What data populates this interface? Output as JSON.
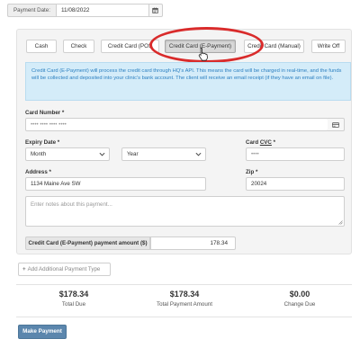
{
  "payment_date": {
    "label": "Payment Date:",
    "value": "11/08/2022",
    "icon": "calendar-icon"
  },
  "tabs": [
    {
      "label": "Cash",
      "active": false
    },
    {
      "label": "Check",
      "active": false
    },
    {
      "label": "Credit Card (POS",
      "active": false
    },
    {
      "label": "Credit Card (E-Payment)",
      "active": true
    },
    {
      "label": "Credit Card (Manual)",
      "active": false
    },
    {
      "label": "Write Off",
      "active": false
    }
  ],
  "info_message": "Credit Card (E-Payment) will process the credit card through HQ's API. This means the card will be charged in real-time, and the funds will be collected and deposited into your clinic's bank account. The client will receive an email receipt (if they have an email on file).",
  "card_number": {
    "label": "Card Number *",
    "placeholder": "•••• •••• •••• ••••",
    "icon": "credit-card-icon"
  },
  "expiry": {
    "label": "Expiry Date *",
    "month": "Month",
    "year": "Year"
  },
  "cvc": {
    "label_prefix": "Card ",
    "label_abbr": "CVC",
    "label_suffix": " *",
    "placeholder": "••••"
  },
  "address": {
    "label": "Address *",
    "value": "1134 Maine Ave SW"
  },
  "zip": {
    "label": "Zip *",
    "value": "20024"
  },
  "notes": {
    "placeholder": "Enter notes about this payment..."
  },
  "amount": {
    "label": "Credit Card (E-Payment) payment amount ($)",
    "value": "178.34"
  },
  "add_payment_type": {
    "label": "Add Additional Payment Type"
  },
  "totals": [
    {
      "value": "$178.34",
      "label": "Total Due"
    },
    {
      "value": "$178.34",
      "label": "Total Payment Amount"
    },
    {
      "value": "$0.00",
      "label": "Change Due"
    }
  ],
  "make_payment": {
    "label": "Make Payment"
  },
  "colors": {
    "info_bg": "#d4ecf9",
    "info_text": "#2b7fc0",
    "primary_button": "#5b86ad",
    "highlight_ring": "#d92b2b"
  }
}
